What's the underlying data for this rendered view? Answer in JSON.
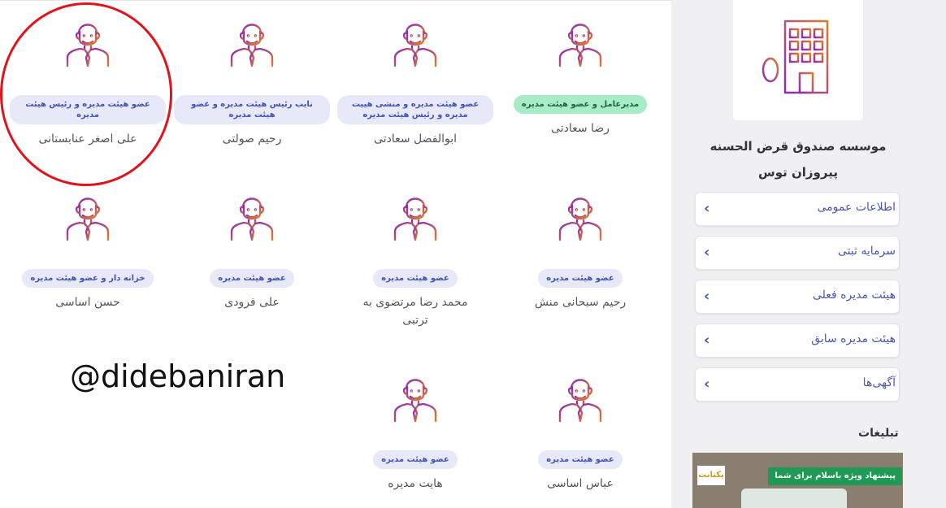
{
  "board_members": [
    {
      "name": "رضا سعادتی",
      "role": "مدیرعامل و عضو هیئت مدیره",
      "highlight": true
    },
    {
      "name": "ابوالفضل سعادتی",
      "role": "عضو هیئت مدیره و منشی هییت مدیره و رئیس هیئت مدیره",
      "highlight": false
    },
    {
      "name": "رحیم صولتی",
      "role": "نایب رئیس هیئت مدیره و عضو هیئت مدیره",
      "highlight": false
    },
    {
      "name": "علی اصغر عنابستانی",
      "role": "عضو هیئت مدیره و رئیس هیئت مدیره",
      "highlight": false
    },
    {
      "name": "رحیم سبحانی منش",
      "role": "عضو هیئت مدیره",
      "highlight": false
    },
    {
      "name": "محمد رضا مرتضوی به ترتبی",
      "role": "عضو هیئت مدیره",
      "highlight": false
    },
    {
      "name": "علی فرودی",
      "role": "عضو هیئت مدیره",
      "highlight": false
    },
    {
      "name": "حسن اساسی",
      "role": "خزانه دار و عضو هیئت مدیره",
      "highlight": false
    },
    {
      "name": "عباس اساسی",
      "role": "عضو هیئت مدیره",
      "highlight": false
    },
    {
      "name": "هایت مدیره",
      "role": "عضو هیئت مدیره",
      "highlight": false
    }
  ],
  "watermark": "@didebaniran",
  "sidebar": {
    "org_name": "موسسه صندوق قرض الحسنه پیروزان توس",
    "menu": [
      {
        "label": "اطلاعات عمومی"
      },
      {
        "label": "سرمایه ثبتی"
      },
      {
        "label": "هیئت مدیره فعلی"
      },
      {
        "label": "هیئت مدیره سابق"
      },
      {
        "label": "آگهی‌ها"
      }
    ],
    "ads_title": "تبلیغات",
    "ad": {
      "banner": "پیشنهاد ویژه باسلام برای شما",
      "logo_text": "یکتانت"
    }
  },
  "colors": {
    "accent": "#4b57b0",
    "role_badge_bg": "#e7e8f8",
    "highlight_badge_bg": "#a8ebc7",
    "annotation": "#e0131c"
  }
}
